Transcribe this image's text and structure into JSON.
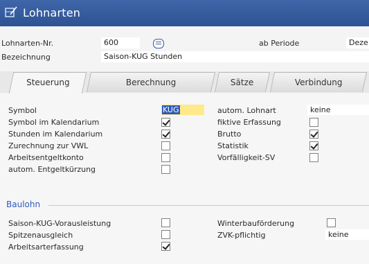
{
  "window": {
    "title": "Lohnarten"
  },
  "header": {
    "nr_label": "Lohnarten-Nr.",
    "nr_value": "600",
    "period_label": "ab Periode",
    "period_value": "Deze",
    "desc_label": "Bezeichnung",
    "desc_value": "Saison-KUG Stunden"
  },
  "tabs": [
    {
      "label": "Steuerung",
      "active": true
    },
    {
      "label": "Berechnung",
      "active": false
    },
    {
      "label": "Sätze",
      "active": false
    },
    {
      "label": "Verbindung",
      "active": false
    }
  ],
  "left_fields": [
    {
      "label": "Symbol",
      "value": "KUG"
    },
    {
      "label": "Symbol im Kalendarium",
      "checked": true
    },
    {
      "label": "Stunden im Kalendarium",
      "checked": true
    },
    {
      "label": "Zurechnung zur VWL",
      "checked": false
    },
    {
      "label": "Arbeitsentgeltkonto",
      "checked": false
    },
    {
      "label": "autom. Entgeltkürzung",
      "checked": false
    }
  ],
  "right_fields": [
    {
      "label": "autom. Lohnart",
      "value": "keine"
    },
    {
      "label": "fiktive Erfassung",
      "checked": false
    },
    {
      "label": "Brutto",
      "checked": true
    },
    {
      "label": "Statistik",
      "checked": true
    },
    {
      "label": "Vorfälligkeit-SV",
      "checked": false
    }
  ],
  "baulohn": {
    "title": "Baulohn",
    "left": [
      {
        "label": "Saison-KUG-Vorausleistung",
        "checked": false
      },
      {
        "label": "Spitzenausgleich",
        "checked": false
      },
      {
        "label": "Arbeitsarterfassung",
        "checked": true
      }
    ],
    "right": [
      {
        "label": "Winterbauförderung",
        "checked": false
      },
      {
        "label": "ZVK-pflichtig",
        "value": "keine"
      }
    ]
  },
  "colors": {
    "titlebar": "#2e5394",
    "accent": "#2e5bc2",
    "highlight": "#ffe98a"
  },
  "icons": {
    "title": "document-pencil-icon",
    "lookup": "list-lookup-icon"
  }
}
